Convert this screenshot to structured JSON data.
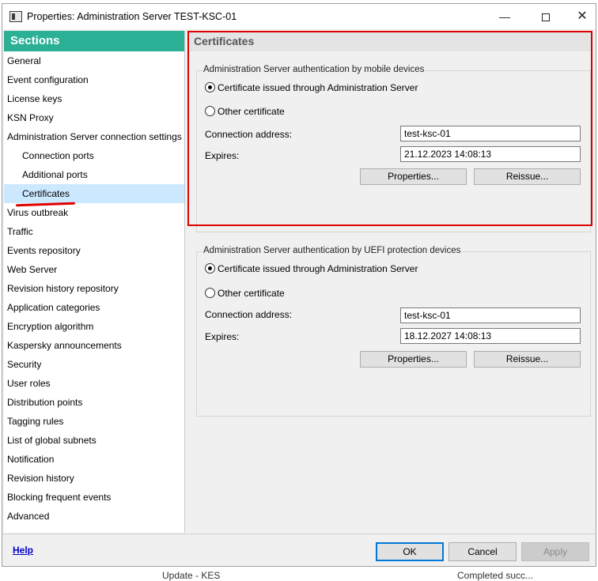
{
  "background": {
    "bottom_left_text": "Update - KES",
    "bottom_right_text": "Completed succ..."
  },
  "window": {
    "title": "Properties: Administration Server TEST-KSC-01",
    "minimize_glyph": "—",
    "close_glyph": "✕"
  },
  "sidebar": {
    "header": "Sections",
    "items": [
      {
        "label": "General"
      },
      {
        "label": "Event configuration"
      },
      {
        "label": "License keys"
      },
      {
        "label": "KSN Proxy"
      },
      {
        "label": "Administration Server connection settings"
      },
      {
        "label": "Connection ports"
      },
      {
        "label": "Additional ports"
      },
      {
        "label": "Certificates"
      },
      {
        "label": "Virus outbreak"
      },
      {
        "label": "Traffic"
      },
      {
        "label": "Events repository"
      },
      {
        "label": "Web Server"
      },
      {
        "label": "Revision history repository"
      },
      {
        "label": "Application categories"
      },
      {
        "label": "Encryption algorithm"
      },
      {
        "label": "Kaspersky announcements"
      },
      {
        "label": "Security"
      },
      {
        "label": "User roles"
      },
      {
        "label": "Distribution points"
      },
      {
        "label": "Tagging rules"
      },
      {
        "label": "List of global subnets"
      },
      {
        "label": "Notification"
      },
      {
        "label": "Revision history"
      },
      {
        "label": "Blocking frequent events"
      },
      {
        "label": "Advanced"
      }
    ]
  },
  "main": {
    "title": "Certificates",
    "mobile": {
      "legend": "Administration Server authentication by mobile devices",
      "option_issued": "Certificate issued through Administration Server",
      "option_other": "Other certificate",
      "connection_label": "Connection address:",
      "connection_value": "test-ksc-01",
      "expires_label": "Expires:",
      "expires_value": "21.12.2023 14:08:13",
      "properties_button": "Properties...",
      "reissue_button": "Reissue..."
    },
    "uefi": {
      "legend": "Administration Server authentication by UEFI protection devices",
      "option_issued": "Certificate issued through Administration Server",
      "option_other": "Other certificate",
      "connection_label": "Connection address:",
      "connection_value": "test-ksc-01",
      "expires_label": "Expires:",
      "expires_value": "18.12.2027 14:08:13",
      "properties_button": "Properties...",
      "reissue_button": "Reissue..."
    }
  },
  "footer": {
    "help": "Help",
    "ok": "OK",
    "cancel": "Cancel",
    "apply": "Apply"
  },
  "colors": {
    "sections_header": "#2bb096",
    "selection": "#cce8ff",
    "annotation_red": "#e00000"
  }
}
